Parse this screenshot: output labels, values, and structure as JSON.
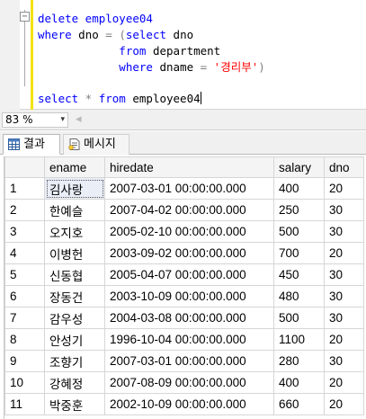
{
  "editor": {
    "outline_toggle": "−",
    "lines": [
      [
        {
          "t": "delete employee04",
          "c": "kw"
        }
      ],
      [
        {
          "t": "where",
          "c": "kw"
        },
        {
          "t": " dno ",
          "c": ""
        },
        {
          "t": "= (",
          "c": "op"
        },
        {
          "t": "select",
          "c": "kw"
        },
        {
          "t": " dno",
          "c": ""
        }
      ],
      [
        {
          "t": "            from",
          "c": "kw"
        },
        {
          "t": " department",
          "c": ""
        }
      ],
      [
        {
          "t": "            where",
          "c": "kw"
        },
        {
          "t": " dname ",
          "c": ""
        },
        {
          "t": "=",
          "c": "op"
        },
        {
          "t": " '경리부'",
          "c": "str"
        },
        {
          "t": ")",
          "c": "op"
        }
      ]
    ],
    "last_line": [
      {
        "t": "select",
        "c": "kw"
      },
      {
        "t": " * ",
        "c": "op"
      },
      {
        "t": "from",
        "c": "kw"
      },
      {
        "t": " employee04",
        "c": ""
      }
    ]
  },
  "zoom": {
    "value": "83 %",
    "arrow": "▾",
    "scroll_left": "◂"
  },
  "tabs": {
    "results": "결과",
    "messages": "메시지"
  },
  "grid": {
    "columns": [
      "ename",
      "hiredate",
      "salary",
      "dno"
    ],
    "rows": [
      [
        "1",
        "김사랑",
        "2007-03-01 00:00:00.000",
        "400",
        "20"
      ],
      [
        "2",
        "한예슬",
        "2007-04-02 00:00:00.000",
        "250",
        "30"
      ],
      [
        "3",
        "오지호",
        "2005-02-10 00:00:00.000",
        "500",
        "30"
      ],
      [
        "4",
        "이병헌",
        "2003-09-02 00:00:00.000",
        "700",
        "20"
      ],
      [
        "5",
        "신동협",
        "2005-04-07 00:00:00.000",
        "450",
        "30"
      ],
      [
        "6",
        "장동건",
        "2003-10-09 00:00:00.000",
        "480",
        "30"
      ],
      [
        "7",
        "감우성",
        "2004-03-08 00:00:00.000",
        "500",
        "30"
      ],
      [
        "8",
        "안성기",
        "1996-10-04 00:00:00.000",
        "1100",
        "20"
      ],
      [
        "9",
        "조향기",
        "2007-03-01 00:00:00.000",
        "280",
        "30"
      ],
      [
        "10",
        "강혜정",
        "2007-08-09 00:00:00.000",
        "400",
        "20"
      ],
      [
        "11",
        "박중훈",
        "2002-10-09 00:00:00.000",
        "660",
        "20"
      ]
    ]
  }
}
